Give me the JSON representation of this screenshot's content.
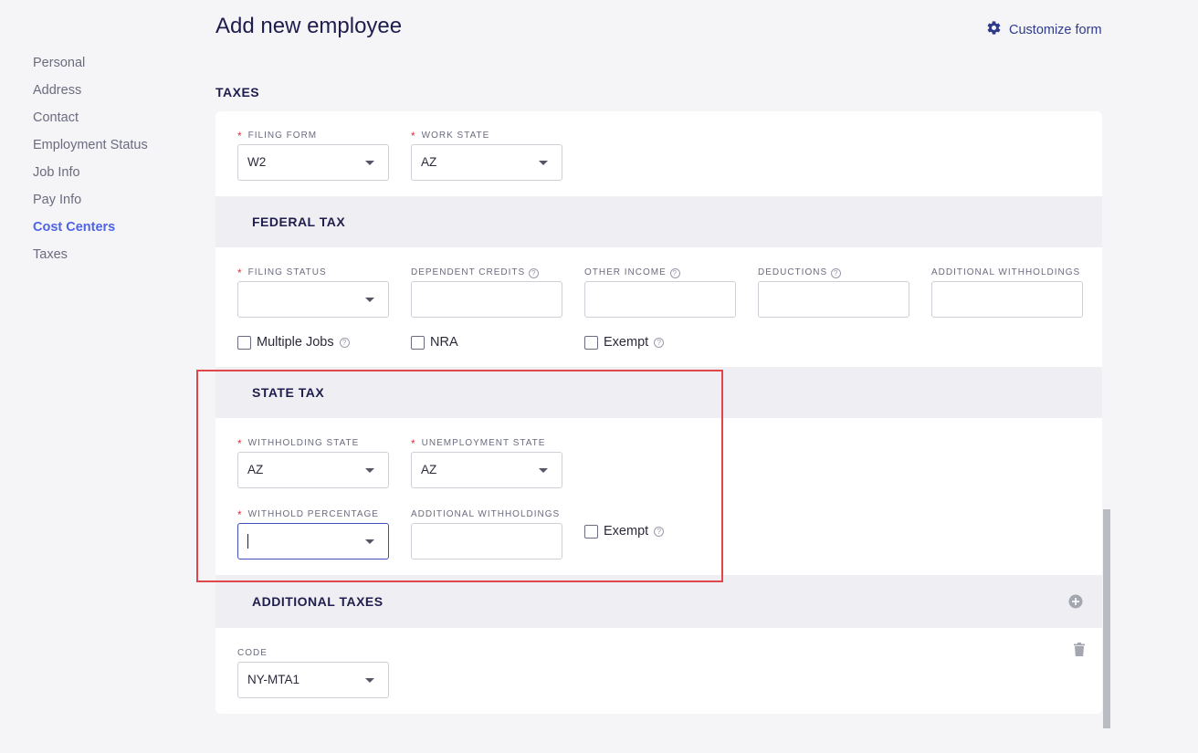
{
  "sidebar": {
    "items": [
      {
        "label": "Personal"
      },
      {
        "label": "Address"
      },
      {
        "label": "Contact"
      },
      {
        "label": "Employment Status"
      },
      {
        "label": "Job Info"
      },
      {
        "label": "Pay Info"
      },
      {
        "label": "Cost Centers",
        "active": true
      },
      {
        "label": "Taxes"
      }
    ]
  },
  "header": {
    "title": "Add new employee",
    "customize_label": "Customize form",
    "customize_icon": "gear-icon"
  },
  "section": {
    "title": "TAXES"
  },
  "top_fields": {
    "filing_form": {
      "label": "FILING FORM",
      "required": true,
      "value": "W2"
    },
    "work_state": {
      "label": "WORK STATE",
      "required": true,
      "value": "AZ"
    }
  },
  "federal": {
    "title": "FEDERAL TAX",
    "filing_status": {
      "label": "FILING STATUS",
      "required": true,
      "value": ""
    },
    "dependent_credits": {
      "label": "DEPENDENT CREDITS",
      "value": ""
    },
    "other_income": {
      "label": "OTHER INCOME",
      "value": ""
    },
    "deductions": {
      "label": "DEDUCTIONS",
      "value": ""
    },
    "additional_withholdings": {
      "label": "ADDITIONAL WITHHOLDINGS",
      "value": ""
    },
    "multiple_jobs": {
      "label": "Multiple Jobs",
      "checked": false
    },
    "nra": {
      "label": "NRA",
      "checked": false
    },
    "exempt": {
      "label": "Exempt",
      "checked": false
    }
  },
  "state": {
    "title": "STATE TAX",
    "withholding_state": {
      "label": "WITHHOLDING STATE",
      "required": true,
      "value": "AZ"
    },
    "unemployment_state": {
      "label": "UNEMPLOYMENT STATE",
      "required": true,
      "value": "AZ"
    },
    "withhold_percentage": {
      "label": "WITHHOLD PERCENTAGE",
      "required": true,
      "value": ""
    },
    "additional_withholdings": {
      "label": "ADDITIONAL WITHHOLDINGS",
      "value": ""
    },
    "exempt": {
      "label": "Exempt",
      "checked": false
    }
  },
  "additional_taxes": {
    "title": "ADDITIONAL TAXES",
    "add_icon": "plus-circle-icon",
    "code": {
      "label": "CODE",
      "value": "NY-MTA1"
    },
    "delete_icon": "trash-icon"
  },
  "colors": {
    "accent": "#4e63e6",
    "highlight": "#e0474a",
    "required": "#d9343a"
  }
}
